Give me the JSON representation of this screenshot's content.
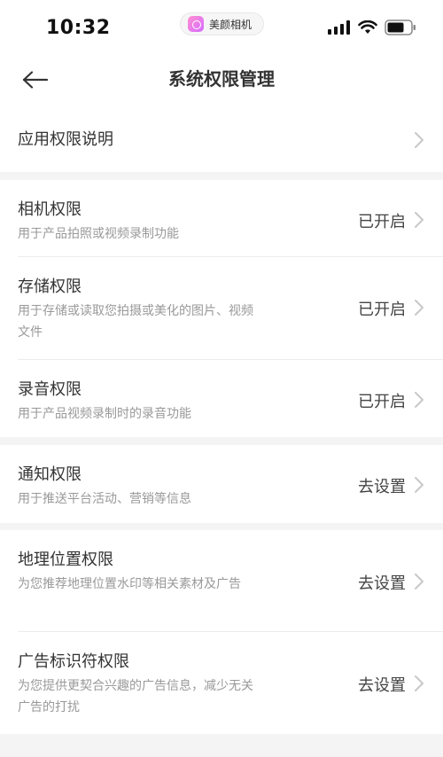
{
  "status_bar": {
    "time": "10:32",
    "app_pill": "美颜相机",
    "icons": [
      "signal-icon",
      "wifi-icon",
      "battery-icon"
    ]
  },
  "nav": {
    "title": "系统权限管理",
    "back_icon": "arrow-left-icon"
  },
  "intro": {
    "title": "应用权限说明"
  },
  "permissions_group1": [
    {
      "title": "相机权限",
      "desc": "用于产品拍照或视频录制功能",
      "status": "已开启"
    },
    {
      "title": "存储权限",
      "desc": "用于存储或读取您拍摄或美化的图片、视频文件",
      "status": "已开启"
    },
    {
      "title": "录音权限",
      "desc": "用于产品视频录制时的录音功能",
      "status": "已开启"
    }
  ],
  "permissions_group2": [
    {
      "title": "通知权限",
      "desc": "用于推送平台活动、营销等信息",
      "status": "去设置"
    }
  ],
  "permissions_group3": [
    {
      "title": "地理位置权限",
      "desc": "为您推荐地理位置水印等相关素材及广告",
      "status": "去设置"
    },
    {
      "title": "广告标识符权限",
      "desc": "为您提供更契合兴趣的广告信息，减少无关广告的打扰",
      "status": "去设置"
    }
  ],
  "colors": {
    "page_bg": "#f4f4f4",
    "card_bg": "#ffffff",
    "chevron": "#c8c8c8"
  }
}
